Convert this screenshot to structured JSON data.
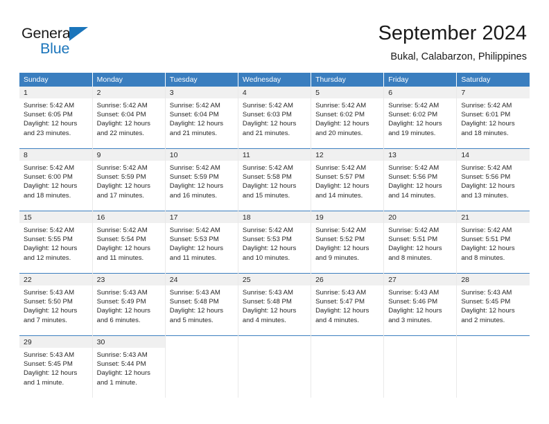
{
  "brand": {
    "name_top": "General",
    "name_bottom": "Blue",
    "accent_color": "#1b75bb"
  },
  "header": {
    "title": "September 2024",
    "subtitle": "Bukal, Calabarzon, Philippines"
  },
  "theme": {
    "header_row_bg": "#3a7ebf",
    "daynum_bg": "#f0f0f0",
    "text_color": "#262626"
  },
  "weekdays": [
    "Sunday",
    "Monday",
    "Tuesday",
    "Wednesday",
    "Thursday",
    "Friday",
    "Saturday"
  ],
  "weeks": [
    [
      {
        "day": "1",
        "sunrise": "Sunrise: 5:42 AM",
        "sunset": "Sunset: 6:05 PM",
        "daylight1": "Daylight: 12 hours",
        "daylight2": "and 23 minutes."
      },
      {
        "day": "2",
        "sunrise": "Sunrise: 5:42 AM",
        "sunset": "Sunset: 6:04 PM",
        "daylight1": "Daylight: 12 hours",
        "daylight2": "and 22 minutes."
      },
      {
        "day": "3",
        "sunrise": "Sunrise: 5:42 AM",
        "sunset": "Sunset: 6:04 PM",
        "daylight1": "Daylight: 12 hours",
        "daylight2": "and 21 minutes."
      },
      {
        "day": "4",
        "sunrise": "Sunrise: 5:42 AM",
        "sunset": "Sunset: 6:03 PM",
        "daylight1": "Daylight: 12 hours",
        "daylight2": "and 21 minutes."
      },
      {
        "day": "5",
        "sunrise": "Sunrise: 5:42 AM",
        "sunset": "Sunset: 6:02 PM",
        "daylight1": "Daylight: 12 hours",
        "daylight2": "and 20 minutes."
      },
      {
        "day": "6",
        "sunrise": "Sunrise: 5:42 AM",
        "sunset": "Sunset: 6:02 PM",
        "daylight1": "Daylight: 12 hours",
        "daylight2": "and 19 minutes."
      },
      {
        "day": "7",
        "sunrise": "Sunrise: 5:42 AM",
        "sunset": "Sunset: 6:01 PM",
        "daylight1": "Daylight: 12 hours",
        "daylight2": "and 18 minutes."
      }
    ],
    [
      {
        "day": "8",
        "sunrise": "Sunrise: 5:42 AM",
        "sunset": "Sunset: 6:00 PM",
        "daylight1": "Daylight: 12 hours",
        "daylight2": "and 18 minutes."
      },
      {
        "day": "9",
        "sunrise": "Sunrise: 5:42 AM",
        "sunset": "Sunset: 5:59 PM",
        "daylight1": "Daylight: 12 hours",
        "daylight2": "and 17 minutes."
      },
      {
        "day": "10",
        "sunrise": "Sunrise: 5:42 AM",
        "sunset": "Sunset: 5:59 PM",
        "daylight1": "Daylight: 12 hours",
        "daylight2": "and 16 minutes."
      },
      {
        "day": "11",
        "sunrise": "Sunrise: 5:42 AM",
        "sunset": "Sunset: 5:58 PM",
        "daylight1": "Daylight: 12 hours",
        "daylight2": "and 15 minutes."
      },
      {
        "day": "12",
        "sunrise": "Sunrise: 5:42 AM",
        "sunset": "Sunset: 5:57 PM",
        "daylight1": "Daylight: 12 hours",
        "daylight2": "and 14 minutes."
      },
      {
        "day": "13",
        "sunrise": "Sunrise: 5:42 AM",
        "sunset": "Sunset: 5:56 PM",
        "daylight1": "Daylight: 12 hours",
        "daylight2": "and 14 minutes."
      },
      {
        "day": "14",
        "sunrise": "Sunrise: 5:42 AM",
        "sunset": "Sunset: 5:56 PM",
        "daylight1": "Daylight: 12 hours",
        "daylight2": "and 13 minutes."
      }
    ],
    [
      {
        "day": "15",
        "sunrise": "Sunrise: 5:42 AM",
        "sunset": "Sunset: 5:55 PM",
        "daylight1": "Daylight: 12 hours",
        "daylight2": "and 12 minutes."
      },
      {
        "day": "16",
        "sunrise": "Sunrise: 5:42 AM",
        "sunset": "Sunset: 5:54 PM",
        "daylight1": "Daylight: 12 hours",
        "daylight2": "and 11 minutes."
      },
      {
        "day": "17",
        "sunrise": "Sunrise: 5:42 AM",
        "sunset": "Sunset: 5:53 PM",
        "daylight1": "Daylight: 12 hours",
        "daylight2": "and 11 minutes."
      },
      {
        "day": "18",
        "sunrise": "Sunrise: 5:42 AM",
        "sunset": "Sunset: 5:53 PM",
        "daylight1": "Daylight: 12 hours",
        "daylight2": "and 10 minutes."
      },
      {
        "day": "19",
        "sunrise": "Sunrise: 5:42 AM",
        "sunset": "Sunset: 5:52 PM",
        "daylight1": "Daylight: 12 hours",
        "daylight2": "and 9 minutes."
      },
      {
        "day": "20",
        "sunrise": "Sunrise: 5:42 AM",
        "sunset": "Sunset: 5:51 PM",
        "daylight1": "Daylight: 12 hours",
        "daylight2": "and 8 minutes."
      },
      {
        "day": "21",
        "sunrise": "Sunrise: 5:42 AM",
        "sunset": "Sunset: 5:51 PM",
        "daylight1": "Daylight: 12 hours",
        "daylight2": "and 8 minutes."
      }
    ],
    [
      {
        "day": "22",
        "sunrise": "Sunrise: 5:43 AM",
        "sunset": "Sunset: 5:50 PM",
        "daylight1": "Daylight: 12 hours",
        "daylight2": "and 7 minutes."
      },
      {
        "day": "23",
        "sunrise": "Sunrise: 5:43 AM",
        "sunset": "Sunset: 5:49 PM",
        "daylight1": "Daylight: 12 hours",
        "daylight2": "and 6 minutes."
      },
      {
        "day": "24",
        "sunrise": "Sunrise: 5:43 AM",
        "sunset": "Sunset: 5:48 PM",
        "daylight1": "Daylight: 12 hours",
        "daylight2": "and 5 minutes."
      },
      {
        "day": "25",
        "sunrise": "Sunrise: 5:43 AM",
        "sunset": "Sunset: 5:48 PM",
        "daylight1": "Daylight: 12 hours",
        "daylight2": "and 4 minutes."
      },
      {
        "day": "26",
        "sunrise": "Sunrise: 5:43 AM",
        "sunset": "Sunset: 5:47 PM",
        "daylight1": "Daylight: 12 hours",
        "daylight2": "and 4 minutes."
      },
      {
        "day": "27",
        "sunrise": "Sunrise: 5:43 AM",
        "sunset": "Sunset: 5:46 PM",
        "daylight1": "Daylight: 12 hours",
        "daylight2": "and 3 minutes."
      },
      {
        "day": "28",
        "sunrise": "Sunrise: 5:43 AM",
        "sunset": "Sunset: 5:45 PM",
        "daylight1": "Daylight: 12 hours",
        "daylight2": "and 2 minutes."
      }
    ],
    [
      {
        "day": "29",
        "sunrise": "Sunrise: 5:43 AM",
        "sunset": "Sunset: 5:45 PM",
        "daylight1": "Daylight: 12 hours",
        "daylight2": "and 1 minute."
      },
      {
        "day": "30",
        "sunrise": "Sunrise: 5:43 AM",
        "sunset": "Sunset: 5:44 PM",
        "daylight1": "Daylight: 12 hours",
        "daylight2": "and 1 minute."
      },
      {
        "day": "",
        "sunrise": "",
        "sunset": "",
        "daylight1": "",
        "daylight2": ""
      },
      {
        "day": "",
        "sunrise": "",
        "sunset": "",
        "daylight1": "",
        "daylight2": ""
      },
      {
        "day": "",
        "sunrise": "",
        "sunset": "",
        "daylight1": "",
        "daylight2": ""
      },
      {
        "day": "",
        "sunrise": "",
        "sunset": "",
        "daylight1": "",
        "daylight2": ""
      },
      {
        "day": "",
        "sunrise": "",
        "sunset": "",
        "daylight1": "",
        "daylight2": ""
      }
    ]
  ]
}
